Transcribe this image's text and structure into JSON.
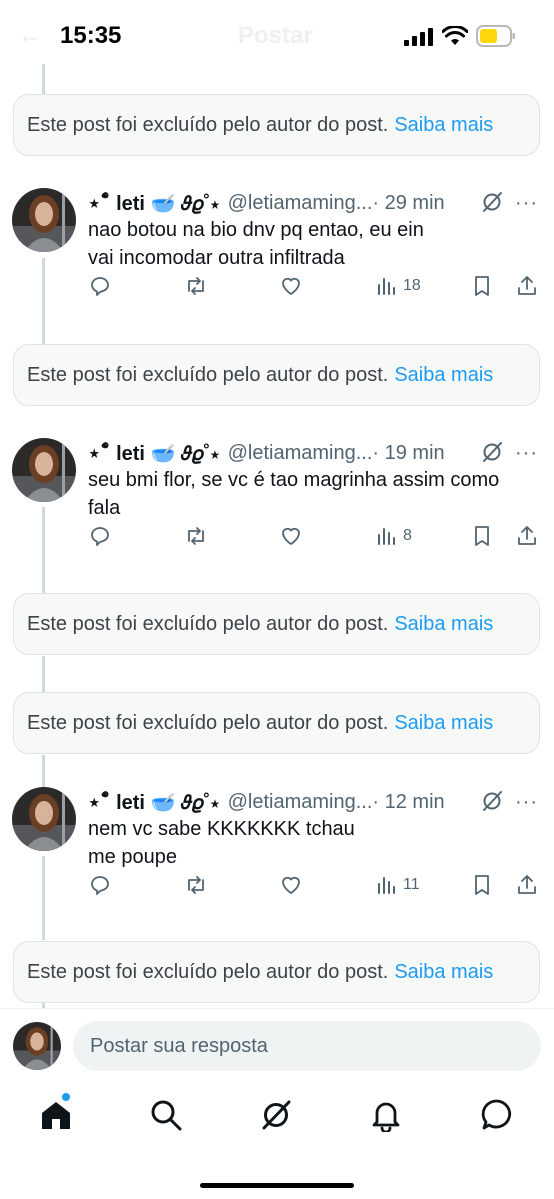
{
  "status_bar": {
    "time": "15:35",
    "ghost_title": "Postar",
    "ghost_back": "←"
  },
  "deleted_notice": {
    "text": "Este post foi excluído pelo autor do post.",
    "link": "Saiba mais"
  },
  "tweets": [
    {
      "name": "⋆˚ໍ leti 🥣 𝜗𝜚˚⋆",
      "handle": "@letiamaming...",
      "time": "· 29 min",
      "text_lines": [
        "nao botou na bio dnv pq entao, eu ein",
        "vai incomodar outra infiltrada"
      ],
      "views": "18"
    },
    {
      "name": "⋆˚ໍ leti 🥣 𝜗𝜚˚⋆",
      "handle": "@letiamaming...",
      "time": "· 19 min",
      "text_lines": [
        "seu bmi flor, se vc é tao magrinha assim como",
        "fala"
      ],
      "views": "8"
    },
    {
      "name": "⋆˚ໍ leti 🥣 𝜗𝜚˚⋆",
      "handle": "@letiamaming...",
      "time": "· 12 min",
      "text_lines": [
        "nem vc sabe KKKKKKK tchau",
        "me poupe"
      ],
      "views": "11"
    }
  ],
  "reply": {
    "placeholder": "Postar sua resposta"
  },
  "more_glyph": "···",
  "icons": {
    "reply": "reply-icon",
    "repost": "repost-icon",
    "like": "like-icon",
    "views": "views-icon",
    "bookmark": "bookmark-icon",
    "share": "share-icon",
    "grok": "grok-icon",
    "nav": [
      "home-icon",
      "search-icon",
      "grok-icon",
      "notifications-icon",
      "messages-icon"
    ]
  },
  "colors": {
    "accent": "#1d9bf0",
    "muted": "#536471",
    "battery": "#ffd60a"
  }
}
